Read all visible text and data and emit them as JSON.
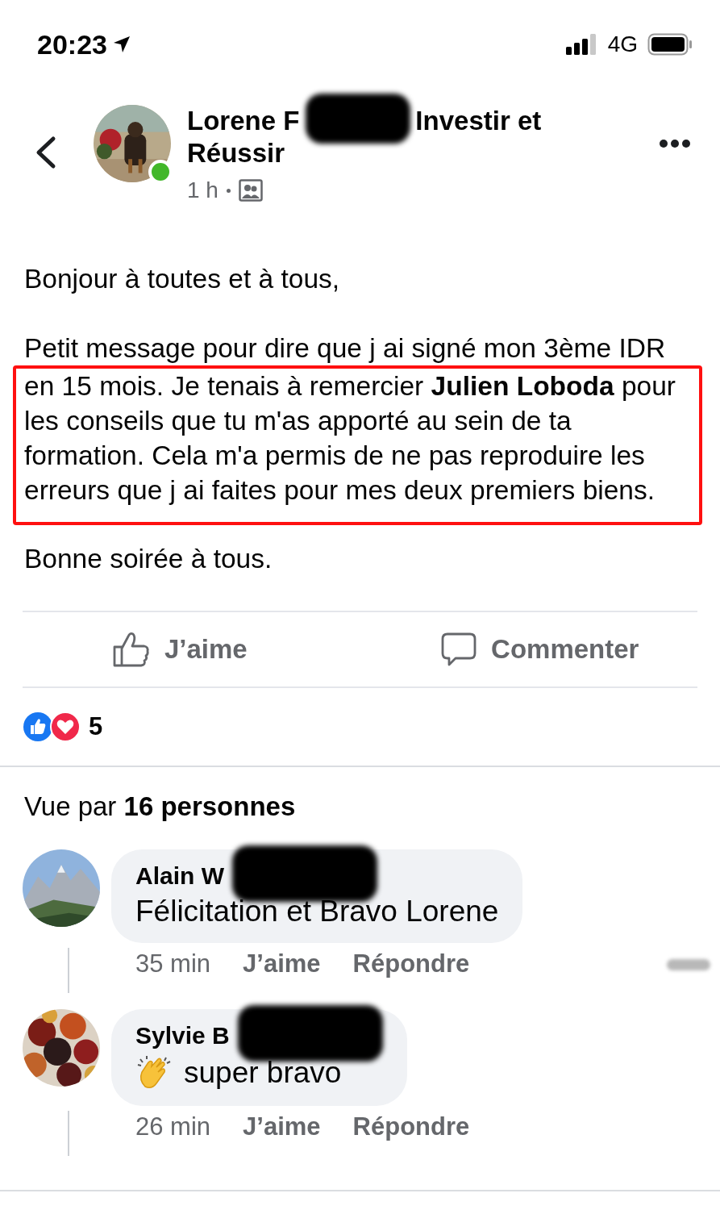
{
  "status_bar": {
    "time": "20:23",
    "network": "4G"
  },
  "post": {
    "author": "Lorene F",
    "group_lines": [
      "Investir et",
      "Réussir"
    ],
    "online": true,
    "time": "1 h",
    "paragraphs": [
      {
        "text": "Bonjour à toutes et à tous,",
        "highlighted": false
      },
      {
        "text": "Petit message pour dire que j ai signé mon 3ème IDR",
        "highlighted": false
      },
      {
        "text": "en 15 mois. Je tenais à remercier **Julien Loboda** pour les conseils que tu m'as apporté au sein de ta formation. Cela m'a permis de ne pas reproduire les erreurs que j ai faites pour mes deux premiers biens.",
        "highlighted": true
      },
      {
        "text": "Bonne soirée à tous.",
        "highlighted": false
      }
    ]
  },
  "actions": [
    {
      "kind": "like",
      "label": "J’aime"
    },
    {
      "kind": "comment",
      "label": "Commenter"
    }
  ],
  "reactions": {
    "count": "5"
  },
  "seen_by": "Vue par **16 personnes**",
  "comments": [
    {
      "kind": "plain",
      "author": "Alain W",
      "text": "Félicitation et Bravo Lorene",
      "time": "35 min",
      "like": "J’aime",
      "reply": "Répondre",
      "smudge": true
    },
    {
      "kind": "clap",
      "author": "Sylvie B",
      "text": "super bravo",
      "time": "26 min",
      "like": "J’aime",
      "reply": "Répondre"
    }
  ]
}
